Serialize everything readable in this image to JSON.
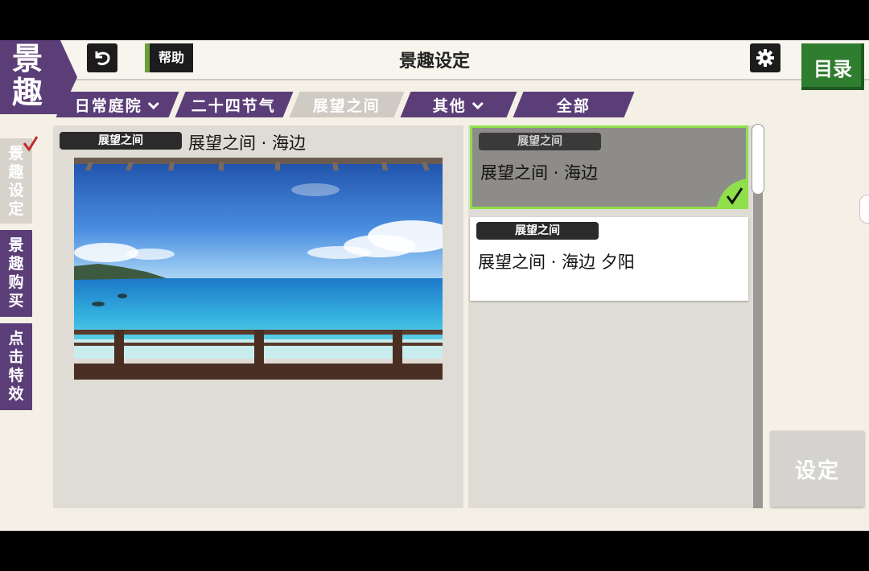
{
  "brand": {
    "text_line1": "景",
    "text_line2": "趣"
  },
  "header": {
    "title": "景趣设定",
    "help_label": "帮助",
    "menu_label": "目录"
  },
  "tabs": [
    {
      "label": "日常庭院",
      "has_dropdown": true
    },
    {
      "label": "二十四节气",
      "has_dropdown": false
    },
    {
      "label": "展望之间",
      "has_dropdown": false,
      "active": true
    },
    {
      "label": "其他",
      "has_dropdown": true
    },
    {
      "label": "全部",
      "has_dropdown": false
    }
  ],
  "side_nav": [
    {
      "label": "景趣设定",
      "active": true
    },
    {
      "label": "景趣购买",
      "active": false
    },
    {
      "label": "点击特效",
      "active": false
    }
  ],
  "preview": {
    "category_label": "展望之间",
    "title": "展望之间 · 海边"
  },
  "list": [
    {
      "category_label": "展望之间",
      "title": "展望之间 · 海边",
      "selected": true
    },
    {
      "category_label": "展望之间",
      "title": "展望之间 · 海边 夕阳",
      "selected": false
    }
  ],
  "set_button": {
    "label": "设定"
  },
  "colors": {
    "accent_purple": "#5b3e78",
    "selected_border": "#8fe04a",
    "menu_green": "#2f7d2f"
  }
}
